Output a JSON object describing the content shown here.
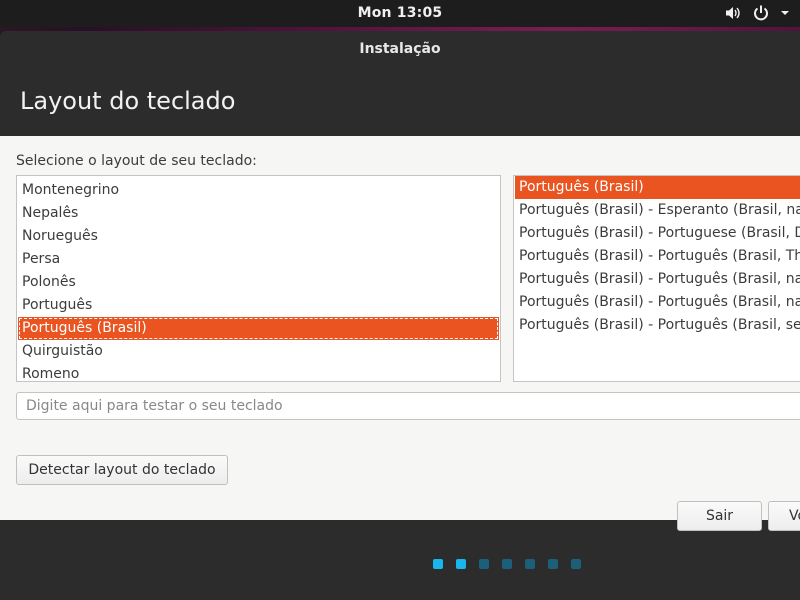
{
  "topbar": {
    "clock": "Mon 13:05",
    "icons": [
      "volume-icon",
      "power-icon",
      "dropdown-arrow-icon"
    ]
  },
  "window": {
    "title": "Instalação",
    "page_title": "Layout do teclado"
  },
  "main": {
    "prompt": "Selecione o layout de seu teclado:",
    "layouts": [
      {
        "label": "Montenegrino",
        "selected": false
      },
      {
        "label": "Nepalês",
        "selected": false
      },
      {
        "label": "Norueguês",
        "selected": false
      },
      {
        "label": "Persa",
        "selected": false
      },
      {
        "label": "Polonês",
        "selected": false
      },
      {
        "label": "Português",
        "selected": false
      },
      {
        "label": "Português (Brasil)",
        "selected": true
      },
      {
        "label": "Quirguistão",
        "selected": false
      },
      {
        "label": "Romeno",
        "selected": false
      }
    ],
    "variants": [
      {
        "label": "Português (Brasil)",
        "selected": true
      },
      {
        "label": "Português (Brasil) - Esperanto (Brasil, nativo)",
        "selected": false
      },
      {
        "label": "Português (Brasil) - Portuguese (Brasil, Dvorak)",
        "selected": false
      },
      {
        "label": "Português (Brasil) - Português (Brasil, ThinkPad)",
        "selected": false
      },
      {
        "label": "Português (Brasil) - Português (Brasil, nativo)",
        "selected": false
      },
      {
        "label": "Português (Brasil) - Português (Brasil, nativo para usuários US)",
        "selected": false
      },
      {
        "label": "Português (Brasil) - Português (Brasil, sem teclas mortas)",
        "selected": false
      }
    ],
    "test_placeholder": "Digite aqui para testar o seu teclado",
    "test_value": "",
    "detect_button": "Detectar layout do teclado"
  },
  "footer": {
    "quit_button": "Sair",
    "back_button": "Voltar",
    "progress_steps_total": 7,
    "progress_steps_done": 2
  },
  "colors": {
    "accent": "#e95420",
    "step_done": "#19b6ee",
    "step_todo": "#1b5f78"
  }
}
